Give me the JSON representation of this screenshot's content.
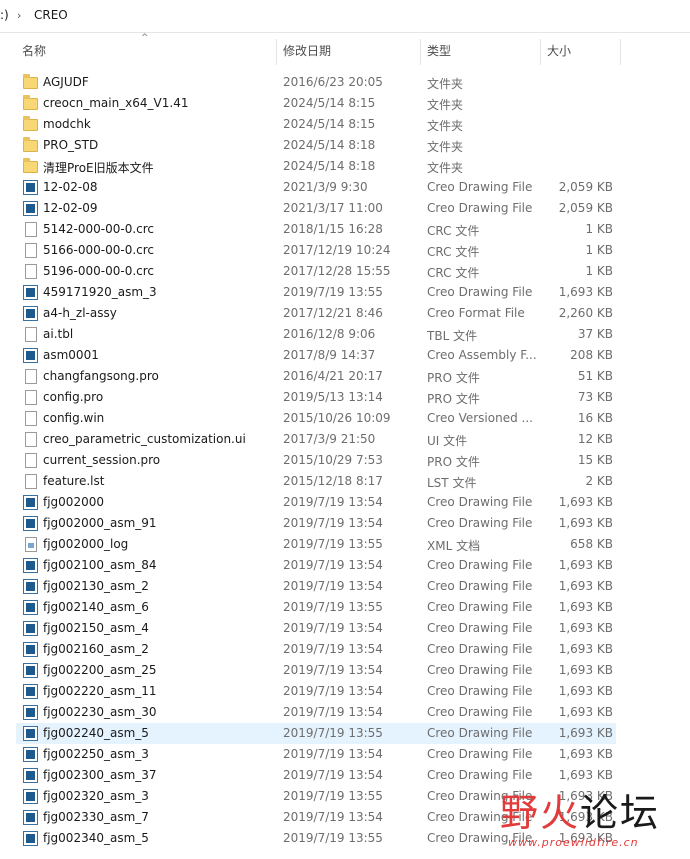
{
  "address": {
    "root": ":)",
    "separator": "›",
    "folder": "CREO"
  },
  "columns": {
    "name": "名称",
    "date": "修改日期",
    "type": "类型",
    "size": "大小"
  },
  "sort_indicator": "^",
  "files": [
    {
      "name": "AGJUDF",
      "date": "2016/6/23 20:05",
      "type": "文件夹",
      "size": "",
      "icon": "folder"
    },
    {
      "name": "creocn_main_x64_V1.41",
      "date": "2024/5/14 8:15",
      "type": "文件夹",
      "size": "",
      "icon": "folder"
    },
    {
      "name": "modchk",
      "date": "2024/5/14 8:15",
      "type": "文件夹",
      "size": "",
      "icon": "folder"
    },
    {
      "name": "PRO_STD",
      "date": "2024/5/14 8:18",
      "type": "文件夹",
      "size": "",
      "icon": "folder"
    },
    {
      "name": "清理ProE旧版本文件",
      "date": "2024/5/14 8:18",
      "type": "文件夹",
      "size": "",
      "icon": "folder"
    },
    {
      "name": "12-02-08",
      "date": "2021/3/9 9:30",
      "type": "Creo Drawing File",
      "size": "2,059 KB",
      "icon": "drawing"
    },
    {
      "name": "12-02-09",
      "date": "2021/3/17 11:00",
      "type": "Creo Drawing File",
      "size": "2,059 KB",
      "icon": "drawing"
    },
    {
      "name": "5142-000-00-0.crc",
      "date": "2018/1/15 16:28",
      "type": "CRC 文件",
      "size": "1 KB",
      "icon": "document"
    },
    {
      "name": "5166-000-00-0.crc",
      "date": "2017/12/19 10:24",
      "type": "CRC 文件",
      "size": "1 KB",
      "icon": "document"
    },
    {
      "name": "5196-000-00-0.crc",
      "date": "2017/12/28 15:55",
      "type": "CRC 文件",
      "size": "1 KB",
      "icon": "document"
    },
    {
      "name": "459171920_asm_3",
      "date": "2019/7/19 13:55",
      "type": "Creo Drawing File",
      "size": "1,693 KB",
      "icon": "drawing"
    },
    {
      "name": "a4-h_zl-assy",
      "date": "2017/12/21 8:46",
      "type": "Creo Format File",
      "size": "2,260 KB",
      "icon": "drawing"
    },
    {
      "name": "ai.tbl",
      "date": "2016/12/8 9:06",
      "type": "TBL 文件",
      "size": "37 KB",
      "icon": "document"
    },
    {
      "name": "asm0001",
      "date": "2017/8/9 14:37",
      "type": "Creo Assembly F...",
      "size": "208 KB",
      "icon": "drawing"
    },
    {
      "name": "changfangsong.pro",
      "date": "2016/4/21 20:17",
      "type": "PRO 文件",
      "size": "51 KB",
      "icon": "document"
    },
    {
      "name": "config.pro",
      "date": "2019/5/13 13:14",
      "type": "PRO 文件",
      "size": "73 KB",
      "icon": "document"
    },
    {
      "name": "config.win",
      "date": "2015/10/26 10:09",
      "type": "Creo Versioned ...",
      "size": "16 KB",
      "icon": "document"
    },
    {
      "name": "creo_parametric_customization.ui",
      "date": "2017/3/9 21:50",
      "type": "UI 文件",
      "size": "12 KB",
      "icon": "document"
    },
    {
      "name": "current_session.pro",
      "date": "2015/10/29 7:53",
      "type": "PRO 文件",
      "size": "15 KB",
      "icon": "document"
    },
    {
      "name": "feature.lst",
      "date": "2015/12/18 8:17",
      "type": "LST 文件",
      "size": "2 KB",
      "icon": "document"
    },
    {
      "name": "fjg002000",
      "date": "2019/7/19 13:54",
      "type": "Creo Drawing File",
      "size": "1,693 KB",
      "icon": "drawing"
    },
    {
      "name": "fjg002000_asm_91",
      "date": "2019/7/19 13:54",
      "type": "Creo Drawing File",
      "size": "1,693 KB",
      "icon": "drawing"
    },
    {
      "name": "fjg002000_log",
      "date": "2019/7/19 13:55",
      "type": "XML 文档",
      "size": "658 KB",
      "icon": "xml"
    },
    {
      "name": "fjg002100_asm_84",
      "date": "2019/7/19 13:54",
      "type": "Creo Drawing File",
      "size": "1,693 KB",
      "icon": "drawing"
    },
    {
      "name": "fjg002130_asm_2",
      "date": "2019/7/19 13:54",
      "type": "Creo Drawing File",
      "size": "1,693 KB",
      "icon": "drawing"
    },
    {
      "name": "fjg002140_asm_6",
      "date": "2019/7/19 13:55",
      "type": "Creo Drawing File",
      "size": "1,693 KB",
      "icon": "drawing"
    },
    {
      "name": "fjg002150_asm_4",
      "date": "2019/7/19 13:54",
      "type": "Creo Drawing File",
      "size": "1,693 KB",
      "icon": "drawing"
    },
    {
      "name": "fjg002160_asm_2",
      "date": "2019/7/19 13:54",
      "type": "Creo Drawing File",
      "size": "1,693 KB",
      "icon": "drawing"
    },
    {
      "name": "fjg002200_asm_25",
      "date": "2019/7/19 13:54",
      "type": "Creo Drawing File",
      "size": "1,693 KB",
      "icon": "drawing"
    },
    {
      "name": "fjg002220_asm_11",
      "date": "2019/7/19 13:54",
      "type": "Creo Drawing File",
      "size": "1,693 KB",
      "icon": "drawing"
    },
    {
      "name": "fjg002230_asm_30",
      "date": "2019/7/19 13:54",
      "type": "Creo Drawing File",
      "size": "1,693 KB",
      "icon": "drawing"
    },
    {
      "name": "fjg002240_asm_5",
      "date": "2019/7/19 13:55",
      "type": "Creo Drawing File",
      "size": "1,693 KB",
      "icon": "drawing",
      "selected": true
    },
    {
      "name": "fjg002250_asm_3",
      "date": "2019/7/19 13:54",
      "type": "Creo Drawing File",
      "size": "1,693 KB",
      "icon": "drawing"
    },
    {
      "name": "fjg002300_asm_37",
      "date": "2019/7/19 13:54",
      "type": "Creo Drawing File",
      "size": "1,693 KB",
      "icon": "drawing"
    },
    {
      "name": "fjg002320_asm_3",
      "date": "2019/7/19 13:55",
      "type": "Creo Drawing File",
      "size": "1,693 KB",
      "icon": "drawing"
    },
    {
      "name": "fjg002330_asm_7",
      "date": "2019/7/19 13:54",
      "type": "Creo Drawing File",
      "size": "1,693 KB",
      "icon": "drawing"
    },
    {
      "name": "fjg002340_asm_5",
      "date": "2019/7/19 13:55",
      "type": "Creo Drawing File",
      "size": "1,693 KB",
      "icon": "drawing"
    }
  ],
  "watermark": {
    "brand_red": "野火",
    "brand_dark": "论坛",
    "url": "www.proewildfire.cn"
  },
  "colors": {
    "selection": "#e5f3ff",
    "folder": "#f8d775",
    "drawing_icon": "#1f5a8f",
    "watermark": "#e23b3b"
  }
}
